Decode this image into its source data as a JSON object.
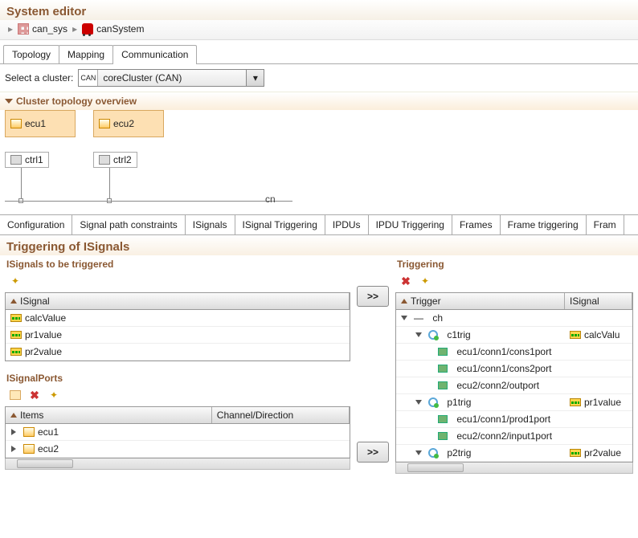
{
  "title": "System editor",
  "breadcrumb": {
    "item1": "can_sys",
    "item2": "canSystem"
  },
  "tabs_main": {
    "t1": "Topology",
    "t2": "Mapping",
    "t3": "Communication"
  },
  "cluster": {
    "label": "Select a cluster:",
    "ico_label": "CAN",
    "value": "coreCluster (CAN)"
  },
  "topo_section": "Cluster topology overview",
  "ecu": {
    "e1": "ecu1",
    "e2": "ecu2"
  },
  "ctrl": {
    "c1": "ctrl1",
    "c2": "ctrl2"
  },
  "ch_label": "cn",
  "tabs_sub": {
    "t1": "Configuration",
    "t2": "Signal path constraints",
    "t3": "ISignals",
    "t4": "ISignal Triggering",
    "t5": "IPDUs",
    "t6": "IPDU Triggering",
    "t7": "Frames",
    "t8": "Frame triggering",
    "t9": "Fram"
  },
  "trig_title": "Triggering of ISignals",
  "left": {
    "h1": "ISignals to be triggered",
    "col1": "ISignal",
    "r1": "calcValue",
    "r2": "pr1value",
    "r3": "pr2value",
    "h2": "ISignalPorts",
    "pcol1": "Items",
    "pcol2": "Channel/Direction",
    "p1": "ecu1",
    "p2": "ecu2"
  },
  "move": ">>",
  "right": {
    "h1": "Triggering",
    "col1": "Trigger",
    "col2": "ISignal",
    "root": "ch",
    "t1": "c1trig",
    "t1sig": "calcValu",
    "t1p1": "ecu1/conn1/cons1port",
    "t1p2": "ecu1/conn1/cons2port",
    "t1p3": "ecu2/conn2/outport",
    "t2": "p1trig",
    "t2sig": "pr1value",
    "t2p1": "ecu1/conn1/prod1port",
    "t2p2": "ecu2/conn2/input1port",
    "t3": "p2trig",
    "t3sig": "pr2value"
  }
}
